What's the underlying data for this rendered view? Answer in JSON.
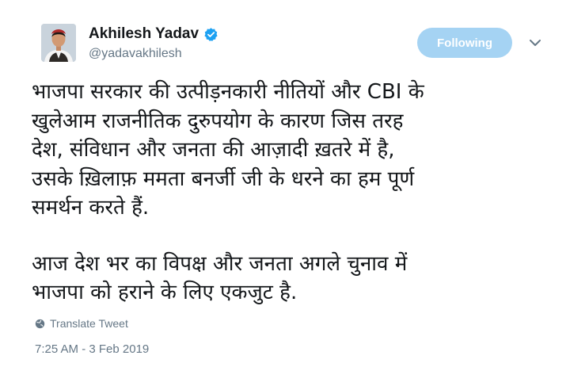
{
  "author": {
    "name": "Akhilesh Yadav",
    "handle": "@yadavakhilesh"
  },
  "follow_button": {
    "label": "Following"
  },
  "tweet": {
    "paragraphs": [
      "भाजपा सरकार की उत्पीड़नकारी नीतियों और CBI के\nखुलेआम राजनीतिक दुरुपयोग के कारण जिस तरह\nदेश, संविधान और जनता की आज़ादी ख़तरे में है,\nउसके ख़िलाफ़ ममता बनर्जी जी के धरने का हम पूर्ण\nसमर्थन करते हैं.",
      "आज देश भर का विपक्ष और जनता अगले चुनाव में\nभाजपा को हराने के लिए एकजुट है."
    ],
    "translate_label": "Translate Tweet",
    "timestamp": "7:25 AM - 3 Feb 2019"
  },
  "icons": {
    "verified": "verified-badge-icon",
    "caret": "chevron-down-icon",
    "globe": "globe-icon"
  },
  "colors": {
    "verified_blue": "#1da1f2",
    "follow_button_bg": "#a5d3f3",
    "secondary_text": "#657786",
    "primary_text": "#14171a"
  }
}
